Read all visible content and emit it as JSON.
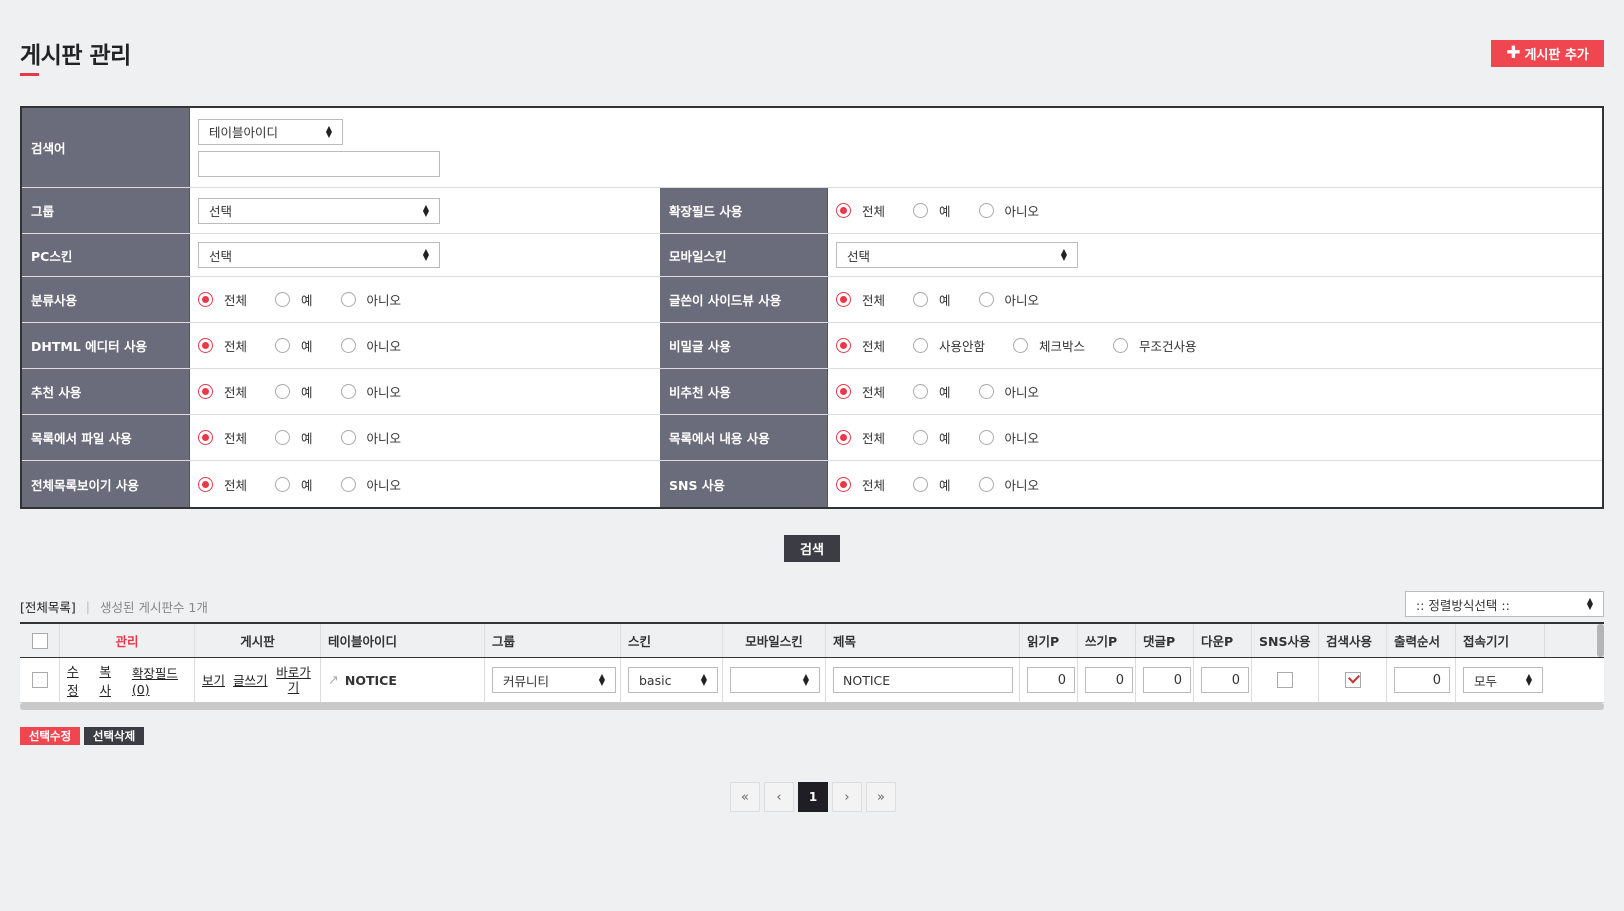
{
  "header": {
    "title": "게시판 관리",
    "add_button": "게시판 추가"
  },
  "search": {
    "keyword_label": "검색어",
    "keyword_select": "테이블아이디",
    "keyword_value": "",
    "rows": [
      {
        "left": {
          "label": "그룹",
          "select": "선택"
        },
        "right": {
          "label": "확장필드 사용",
          "options": [
            "전체",
            "예",
            "아니오"
          ]
        }
      },
      {
        "left": {
          "label": "PC스킨",
          "select": "선택"
        },
        "right": {
          "label": "모바일스킨",
          "select": "선택"
        }
      },
      {
        "left": {
          "label": "분류사용",
          "options": [
            "전체",
            "예",
            "아니오"
          ]
        },
        "right": {
          "label": "글쓴이 사이드뷰 사용",
          "options": [
            "전체",
            "예",
            "아니오"
          ]
        }
      },
      {
        "left": {
          "label": "DHTML 에디터 사용",
          "options": [
            "전체",
            "예",
            "아니오"
          ]
        },
        "right": {
          "label": "비밀글 사용",
          "options": [
            "전체",
            "사용안함",
            "체크박스",
            "무조건사용"
          ]
        }
      },
      {
        "left": {
          "label": "추천 사용",
          "options": [
            "전체",
            "예",
            "아니오"
          ]
        },
        "right": {
          "label": "비추천 사용",
          "options": [
            "전체",
            "예",
            "아니오"
          ]
        }
      },
      {
        "left": {
          "label": "목록에서 파일 사용",
          "options": [
            "전체",
            "예",
            "아니오"
          ]
        },
        "right": {
          "label": "목록에서 내용 사용",
          "options": [
            "전체",
            "예",
            "아니오"
          ]
        }
      },
      {
        "left": {
          "label": "전체목록보이기 사용",
          "options": [
            "전체",
            "예",
            "아니오"
          ]
        },
        "right": {
          "label": "SNS 사용",
          "options": [
            "전체",
            "예",
            "아니오"
          ]
        }
      }
    ],
    "submit": "검색"
  },
  "list": {
    "all_label": "[전체목록]",
    "count_text": "생성된 게시판수 1개",
    "sort_placeholder": ":: 정렬방식선택 ::",
    "columns": [
      "관리",
      "게시판",
      "테이블아이디",
      "그룹",
      "스킨",
      "모바일스킨",
      "제목",
      "읽기P",
      "쓰기P",
      "댓글P",
      "다운P",
      "SNS사용",
      "검색사용",
      "출력순서",
      "접속기기"
    ],
    "rows": [
      {
        "manage": [
          "수정",
          "복사",
          "확장필드(0)"
        ],
        "board": [
          "보기",
          "글쓰기",
          "바로가기"
        ],
        "table_id": "NOTICE",
        "group": "커뮤니티",
        "skin": "basic",
        "mobile_skin": "",
        "title": "NOTICE",
        "read_p": "0",
        "write_p": "0",
        "comment_p": "0",
        "down_p": "0",
        "sns": false,
        "search": true,
        "order": "0",
        "device": "모두"
      }
    ]
  },
  "actions": {
    "modify": "선택수정",
    "delete": "선택삭제"
  },
  "pager": {
    "first": "«",
    "prev": "‹",
    "current": "1",
    "next": "›",
    "last": "»"
  },
  "colors": {
    "accent": "#f0464f",
    "header_bg": "#6b6c7b",
    "dark_btn": "#3c3d44"
  }
}
